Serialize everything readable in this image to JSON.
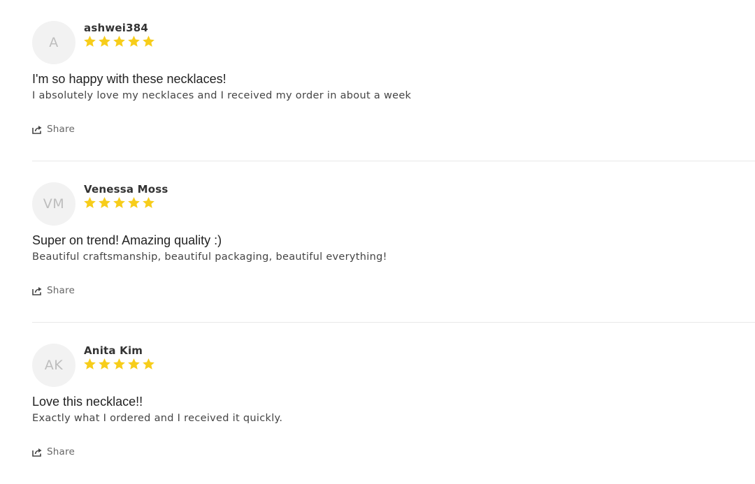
{
  "colors": {
    "star": "#F7CD1A",
    "avatar_bg": "#F2F2F2",
    "avatar_text": "#BDBDBD",
    "divider": "#E8E8E8"
  },
  "reviews": [
    {
      "initials": "A",
      "author": "ashwei384",
      "rating": 5,
      "title": "I'm so happy with these necklaces!",
      "body": "I absolutely love my necklaces and I received my order in about a week",
      "share_label": "Share",
      "share_icon": "share-icon"
    },
    {
      "initials": "VM",
      "author": "Venessa Moss",
      "rating": 5,
      "title": "Super on trend! Amazing quality :)",
      "body": "Beautiful craftsmanship, beautiful packaging, beautiful everything!",
      "share_label": "Share",
      "share_icon": "share-icon"
    },
    {
      "initials": "AK",
      "author": "Anita Kim",
      "rating": 5,
      "title": "Love this necklace!!",
      "body": "Exactly what I ordered and I received it quickly.",
      "share_label": "Share",
      "share_icon": "share-icon"
    }
  ]
}
